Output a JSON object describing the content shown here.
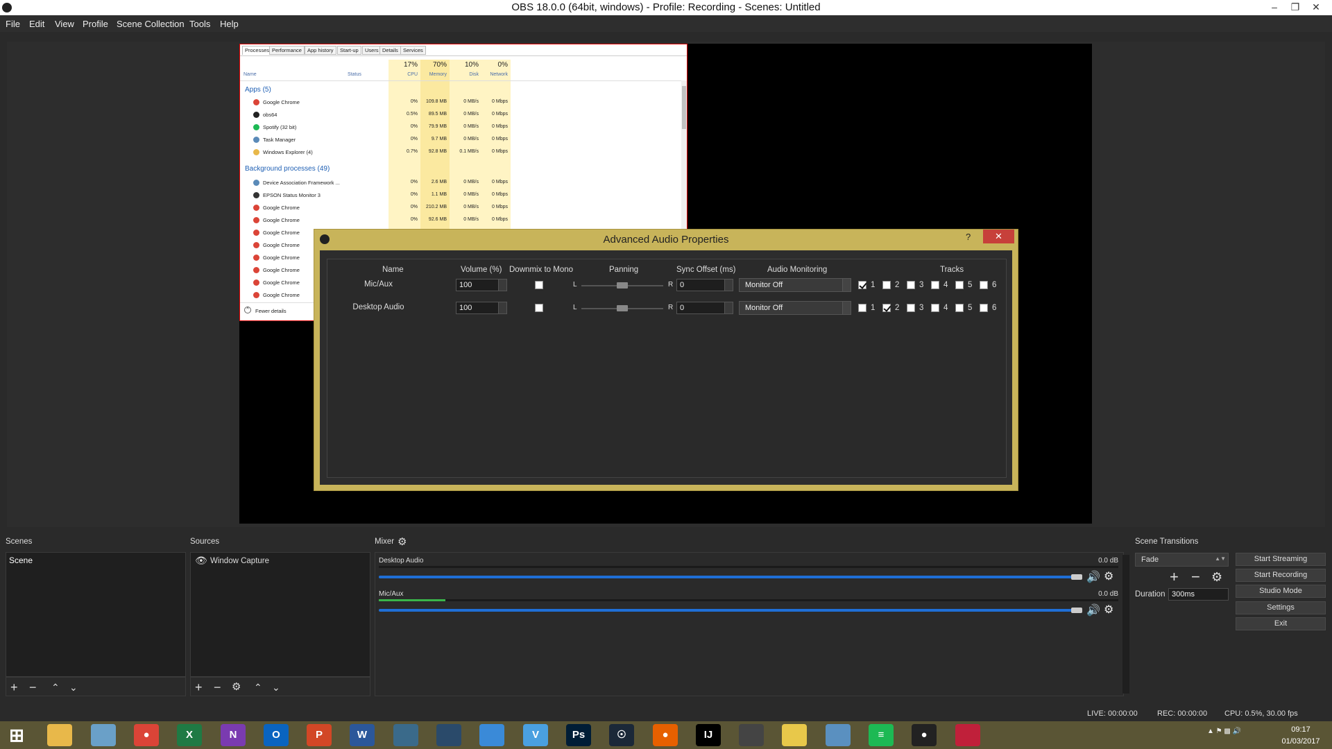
{
  "window": {
    "title": "OBS 18.0.0 (64bit, windows) - Profile: Recording - Scenes: Untitled"
  },
  "menu": [
    "File",
    "Edit",
    "View",
    "Profile",
    "Scene Collection",
    "Tools",
    "Help"
  ],
  "taskmgr": {
    "tabs": [
      "Processes",
      "Performance",
      "App history",
      "Start-up",
      "Users",
      "Details",
      "Services"
    ],
    "header": {
      "cpu_pct": "17%",
      "cpu_label": "CPU",
      "mem_pct": "70%",
      "mem_label": "Memory",
      "disk_pct": "10%",
      "disk_label": "Disk",
      "net_pct": "0%",
      "net_label": "Network",
      "name_label": "Name",
      "status_label": "Status"
    },
    "apps_group": "Apps (5)",
    "bg_group": "Background processes (49)",
    "apps": [
      {
        "name": "Google Chrome",
        "cpu": "0%",
        "mem": "109.8 MB",
        "disk": "0 MB/s",
        "net": "0 Mbps",
        "color": "#db4437"
      },
      {
        "name": "obs64",
        "cpu": "0.5%",
        "mem": "89.5 MB",
        "disk": "0 MB/s",
        "net": "0 Mbps",
        "color": "#222222"
      },
      {
        "name": "Spotify (32 bit)",
        "cpu": "0%",
        "mem": "79.9 MB",
        "disk": "0 MB/s",
        "net": "0 Mbps",
        "color": "#1db954"
      },
      {
        "name": "Task Manager",
        "cpu": "0%",
        "mem": "9.7 MB",
        "disk": "0 MB/s",
        "net": "0 Mbps",
        "color": "#5a8ab8"
      },
      {
        "name": "Windows Explorer (4)",
        "cpu": "0.7%",
        "mem": "92.8 MB",
        "disk": "0.1 MB/s",
        "net": "0 Mbps",
        "color": "#e8b84a"
      }
    ],
    "background": [
      {
        "name": "Device Association Framework ...",
        "cpu": "0%",
        "mem": "2.6 MB",
        "disk": "0 MB/s",
        "net": "0 Mbps",
        "color": "#5a8ab8"
      },
      {
        "name": "EPSON Status Monitor 3",
        "cpu": "0%",
        "mem": "1.1 MB",
        "disk": "0 MB/s",
        "net": "0 Mbps",
        "color": "#333333"
      },
      {
        "name": "Google Chrome",
        "cpu": "0%",
        "mem": "210.2 MB",
        "disk": "0 MB/s",
        "net": "0 Mbps",
        "color": "#db4437"
      },
      {
        "name": "Google Chrome",
        "cpu": "0%",
        "mem": "92.6 MB",
        "disk": "0 MB/s",
        "net": "0 Mbps",
        "color": "#db4437"
      },
      {
        "name": "Google Chrome",
        "color": "#db4437"
      },
      {
        "name": "Google Chrome",
        "color": "#db4437"
      },
      {
        "name": "Google Chrome",
        "color": "#db4437"
      },
      {
        "name": "Google Chrome",
        "color": "#db4437"
      },
      {
        "name": "Google Chrome",
        "color": "#db4437"
      },
      {
        "name": "Google Chrome",
        "color": "#db4437"
      }
    ],
    "fewer_details": "Fewer details"
  },
  "dialog": {
    "title": "Advanced Audio Properties",
    "help": "?",
    "headers": {
      "name": "Name",
      "volume": "Volume (%)",
      "downmix": "Downmix to Mono",
      "panning": "Panning",
      "sync": "Sync Offset (ms)",
      "monitoring": "Audio Monitoring",
      "tracks": "Tracks"
    },
    "rows": [
      {
        "name": "Mic/Aux",
        "volume": "100",
        "downmix": false,
        "pan_left": "L",
        "pan_right": "R",
        "pan": 0.5,
        "sync": "0",
        "monitoring": "Monitor Off",
        "tracks": [
          true,
          false,
          false,
          false,
          false,
          false
        ]
      },
      {
        "name": "Desktop Audio",
        "volume": "100",
        "downmix": false,
        "pan_left": "L",
        "pan_right": "R",
        "pan": 0.5,
        "sync": "0",
        "monitoring": "Monitor Off",
        "tracks": [
          false,
          true,
          false,
          false,
          false,
          false
        ]
      }
    ],
    "track_labels": [
      "1",
      "2",
      "3",
      "4",
      "5",
      "6"
    ]
  },
  "scenes": {
    "header": "Scenes",
    "items": [
      "Scene"
    ]
  },
  "sources": {
    "header": "Sources",
    "items": [
      "Window Capture"
    ]
  },
  "mixer": {
    "header": "Mixer",
    "channels": [
      {
        "name": "Desktop Audio",
        "db": "0.0 dB",
        "volume": 1.0
      },
      {
        "name": "Mic/Aux",
        "db": "0.0 dB",
        "volume": 1.0,
        "level": 0.09
      }
    ]
  },
  "transitions": {
    "header": "Scene Transitions",
    "selected": "Fade",
    "duration_label": "Duration",
    "duration": "300ms"
  },
  "controls": [
    "Start Streaming",
    "Start Recording",
    "Studio Mode",
    "Settings",
    "Exit"
  ],
  "status": {
    "live": "LIVE: 00:00:00",
    "rec": "REC: 00:00:00",
    "cpu": "CPU: 0.5%, 30.00 fps"
  },
  "taskbar": {
    "apps": [
      "start",
      "file-explorer",
      "paint",
      "chrome",
      "excel",
      "onenote",
      "outlook",
      "powerpoint",
      "word",
      "app-misc",
      "app-tree",
      "app-cloud",
      "app-v",
      "photoshop",
      "steam",
      "firefox",
      "intellij",
      "app-bird",
      "app-leaf",
      "app-monitor",
      "spotify",
      "obs",
      "app-red"
    ],
    "time": "09:17",
    "date": "01/03/2017"
  }
}
